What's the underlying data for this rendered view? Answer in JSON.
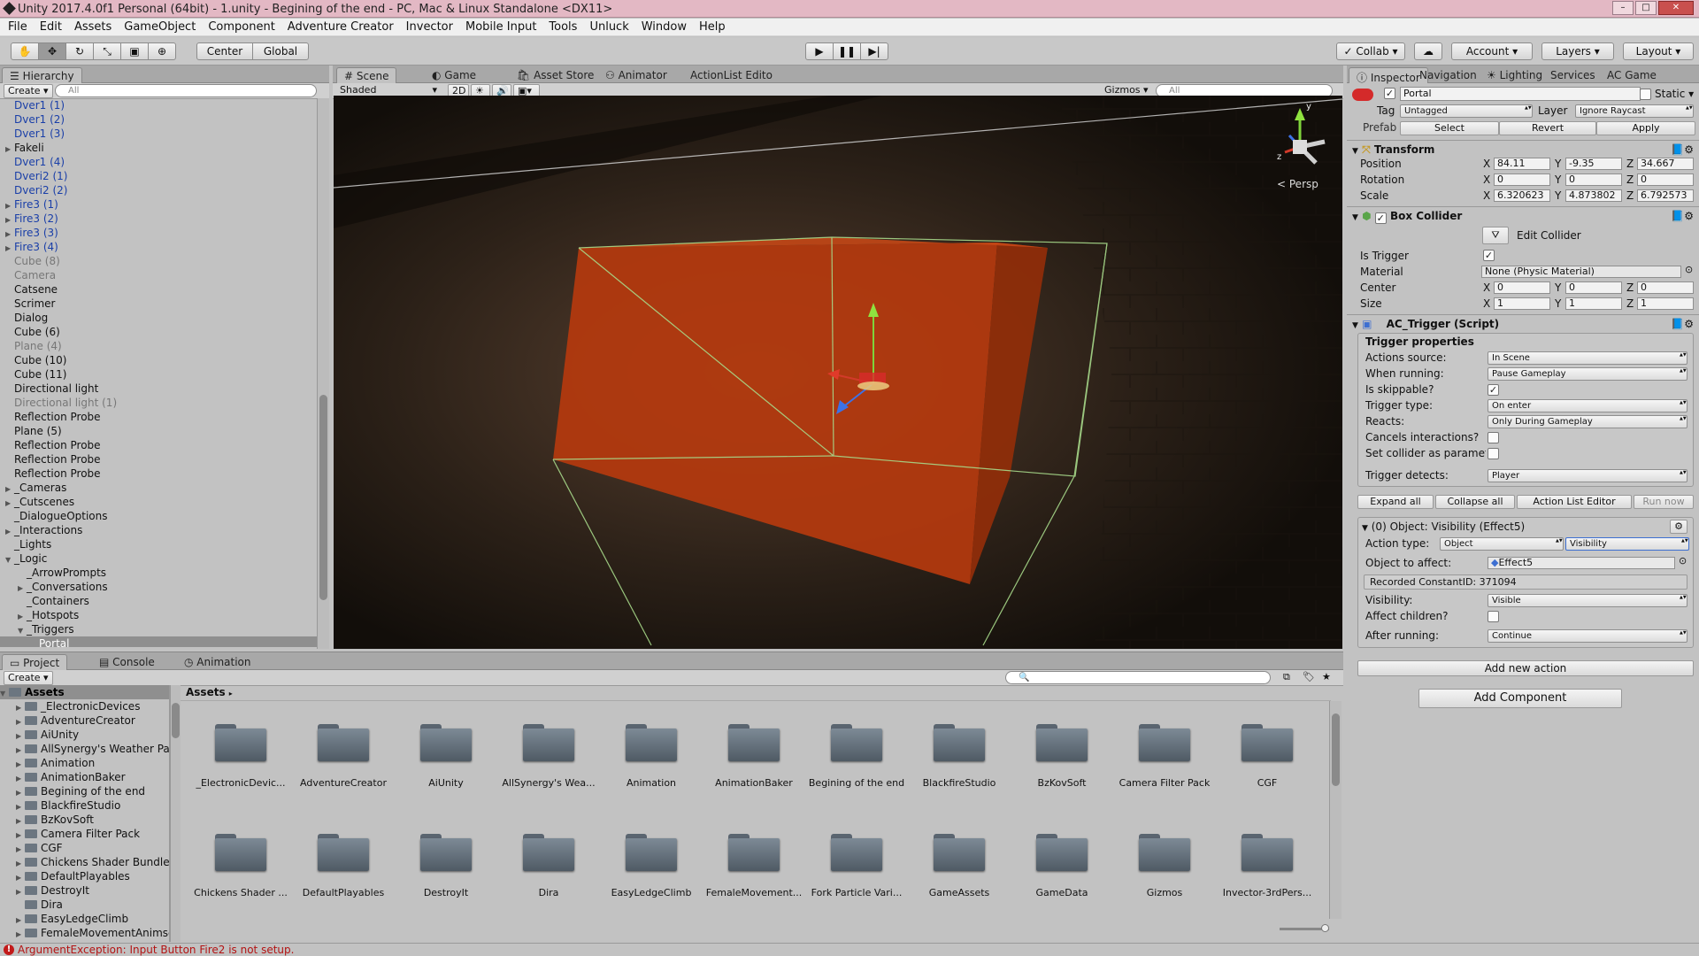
{
  "window": {
    "title": "Unity 2017.4.0f1 Personal (64bit) - 1.unity - Begining of the end - PC, Mac & Linux Standalone <DX11>"
  },
  "menu": [
    "File",
    "Edit",
    "Assets",
    "GameObject",
    "Component",
    "Adventure Creator",
    "Invector",
    "Mobile Input",
    "Tools",
    "Unluck",
    "Window",
    "Help"
  ],
  "toolbar": {
    "pivot": "Center",
    "space": "Global",
    "collab": "Collab",
    "account": "Account",
    "layers": "Layers",
    "layout": "Layout"
  },
  "hierarchy": {
    "tab": "Hierarchy",
    "create": "Create",
    "search_placeholder": "All",
    "rows": [
      {
        "label": "Dver1 (1)",
        "color": "blue",
        "indent": 0,
        "arrow": ""
      },
      {
        "label": "Dver1 (2)",
        "color": "blue",
        "indent": 0,
        "arrow": ""
      },
      {
        "label": "Dver1 (3)",
        "color": "blue",
        "indent": 0,
        "arrow": ""
      },
      {
        "label": "Fakeli",
        "color": "black",
        "indent": 0,
        "arrow": "▶"
      },
      {
        "label": "Dver1 (4)",
        "color": "blue",
        "indent": 0,
        "arrow": ""
      },
      {
        "label": "Dveri2 (1)",
        "color": "blue",
        "indent": 0,
        "arrow": ""
      },
      {
        "label": "Dveri2 (2)",
        "color": "blue",
        "indent": 0,
        "arrow": ""
      },
      {
        "label": "Fire3 (1)",
        "color": "blue",
        "indent": 0,
        "arrow": "▶"
      },
      {
        "label": "Fire3 (2)",
        "color": "blue",
        "indent": 0,
        "arrow": "▶"
      },
      {
        "label": "Fire3 (3)",
        "color": "blue",
        "indent": 0,
        "arrow": "▶"
      },
      {
        "label": "Fire3 (4)",
        "color": "blue",
        "indent": 0,
        "arrow": "▶"
      },
      {
        "label": "Cube (8)",
        "color": "dim",
        "indent": 0,
        "arrow": ""
      },
      {
        "label": "Camera",
        "color": "dim",
        "indent": 0,
        "arrow": ""
      },
      {
        "label": "Catsene",
        "color": "black",
        "indent": 0,
        "arrow": ""
      },
      {
        "label": "Scrimer",
        "color": "black",
        "indent": 0,
        "arrow": ""
      },
      {
        "label": "Dialog",
        "color": "black",
        "indent": 0,
        "arrow": ""
      },
      {
        "label": "Cube (6)",
        "color": "black",
        "indent": 0,
        "arrow": ""
      },
      {
        "label": "Plane (4)",
        "color": "dim",
        "indent": 0,
        "arrow": ""
      },
      {
        "label": "Cube (10)",
        "color": "black",
        "indent": 0,
        "arrow": ""
      },
      {
        "label": "Cube (11)",
        "color": "black",
        "indent": 0,
        "arrow": ""
      },
      {
        "label": "Directional light",
        "color": "black",
        "indent": 0,
        "arrow": ""
      },
      {
        "label": "Directional light (1)",
        "color": "dim",
        "indent": 0,
        "arrow": ""
      },
      {
        "label": "Reflection Probe",
        "color": "black",
        "indent": 0,
        "arrow": ""
      },
      {
        "label": "Plane (5)",
        "color": "black",
        "indent": 0,
        "arrow": ""
      },
      {
        "label": "Reflection Probe",
        "color": "black",
        "indent": 0,
        "arrow": ""
      },
      {
        "label": "Reflection Probe",
        "color": "black",
        "indent": 0,
        "arrow": ""
      },
      {
        "label": "Reflection Probe",
        "color": "black",
        "indent": 0,
        "arrow": ""
      },
      {
        "label": "_Cameras",
        "color": "black",
        "indent": 0,
        "arrow": "▶"
      },
      {
        "label": "_Cutscenes",
        "color": "black",
        "indent": 0,
        "arrow": "▶"
      },
      {
        "label": "_DialogueOptions",
        "color": "black",
        "indent": 0,
        "arrow": ""
      },
      {
        "label": "_Interactions",
        "color": "black",
        "indent": 0,
        "arrow": "▶"
      },
      {
        "label": "_Lights",
        "color": "black",
        "indent": 0,
        "arrow": ""
      },
      {
        "label": "_Logic",
        "color": "black",
        "indent": 0,
        "arrow": "▼"
      },
      {
        "label": "_ArrowPrompts",
        "color": "black",
        "indent": 1,
        "arrow": ""
      },
      {
        "label": "_Conversations",
        "color": "black",
        "indent": 1,
        "arrow": "▶"
      },
      {
        "label": "_Containers",
        "color": "black",
        "indent": 1,
        "arrow": ""
      },
      {
        "label": "_Hotspots",
        "color": "black",
        "indent": 1,
        "arrow": "▶"
      },
      {
        "label": "_Triggers",
        "color": "black",
        "indent": 1,
        "arrow": "▼"
      },
      {
        "label": "Portal",
        "color": "black",
        "indent": 2,
        "arrow": "",
        "selected": true
      }
    ]
  },
  "scene": {
    "tabs": [
      "Scene",
      "Game",
      "Asset Store",
      "Animator",
      "ActionList Edito"
    ],
    "shading": "Shaded",
    "mode2d": "2D",
    "gizmos": "Gizmos",
    "search_placeholder": "All",
    "persp": "Persp"
  },
  "inspector": {
    "tabs": [
      "Inspector",
      "Navigation",
      "Lighting",
      "Services",
      "AC Game"
    ],
    "object_name": "Portal",
    "static": "Static",
    "tag_label": "Tag",
    "tag": "Untagged",
    "layer_label": "Layer",
    "layer": "Ignore Raycast",
    "prefab_label": "Prefab",
    "prefab_select": "Select",
    "prefab_revert": "Revert",
    "prefab_apply": "Apply",
    "transform": {
      "title": "Transform",
      "position": {
        "label": "Position",
        "x": "84.11",
        "y": "-9.35",
        "z": "34.667"
      },
      "rotation": {
        "label": "Rotation",
        "x": "0",
        "y": "0",
        "z": "0"
      },
      "scale": {
        "label": "Scale",
        "x": "6.320623",
        "y": "4.873802",
        "z": "6.792573"
      }
    },
    "box_collider": {
      "title": "Box Collider",
      "edit": "Edit Collider",
      "is_trigger_label": "Is Trigger",
      "material_label": "Material",
      "material": "None (Physic Material)",
      "center": {
        "label": "Center",
        "x": "0",
        "y": "0",
        "z": "0"
      },
      "size": {
        "label": "Size",
        "x": "1",
        "y": "1",
        "z": "1"
      }
    },
    "ac_trigger": {
      "title": "AC_Trigger (Script)",
      "section": "Trigger properties",
      "actions_source_label": "Actions source:",
      "actions_source": "In Scene",
      "when_running_label": "When running:",
      "when_running": "Pause Gameplay",
      "skippable_label": "Is skippable?",
      "trigger_type_label": "Trigger type:",
      "trigger_type": "On enter",
      "reacts_label": "Reacts:",
      "reacts": "Only During Gameplay",
      "cancels_label": "Cancels interactions?",
      "set_collider_label": "Set collider as paramete",
      "detects_label": "Trigger detects:",
      "detects": "Player",
      "buttons": [
        "Expand all",
        "Collapse all",
        "Action List Editor",
        "Run now"
      ],
      "action": {
        "header": "(0) Object: Visibility (Effect5)",
        "type_label": "Action type:",
        "type_a": "Object",
        "type_b": "Visibility",
        "affect_label": "Object to affect:",
        "affect": "Effect5",
        "constant": "Recorded ConstantID: 371094",
        "visibility_label": "Visibility:",
        "visibility": "Visible",
        "children_label": "Affect children?",
        "after_label": "After running:",
        "after": "Continue"
      },
      "add_action": "Add new action"
    },
    "add_component": "Add Component"
  },
  "project": {
    "tabs": [
      "Project",
      "Console",
      "Animation"
    ],
    "create": "Create",
    "root": "Assets",
    "breadcrumb": "Assets",
    "tree": [
      "_ElectronicDevices",
      "AdventureCreator",
      "AiUnity",
      "AllSynergy's Weather Pa",
      "Animation",
      "AnimationBaker",
      "Begining of the end",
      "BlackfireStudio",
      "BzKovSoft",
      "Camera Filter Pack",
      "CGF",
      "Chickens Shader Bundle",
      "DefaultPlayables",
      "DestroyIt",
      "Dira",
      "EasyLedgeClimb",
      "FemaleMovementAnimse"
    ],
    "grid_row1": [
      "_ElectronicDevic...",
      "AdventureCreator",
      "AiUnity",
      "AllSynergy's Wea...",
      "Animation",
      "AnimationBaker",
      "Begining of the end",
      "BlackfireStudio",
      "BzKovSoft",
      "Camera Filter Pack",
      "CGF"
    ],
    "grid_row2": [
      "Chickens Shader ...",
      "DefaultPlayables",
      "DestroyIt",
      "Dira",
      "EasyLedgeClimb",
      "FemaleMovement...",
      "Fork Particle Vari...",
      "GameAssets",
      "GameData",
      "Gizmos",
      "Invector-3rdPers..."
    ]
  },
  "status": {
    "message": "ArgumentException: Input Button Fire2 is not setup."
  },
  "colors": {
    "orange_box": "#b53a0e",
    "wire": "#a7d98a",
    "accent": "#3d6fd1"
  }
}
